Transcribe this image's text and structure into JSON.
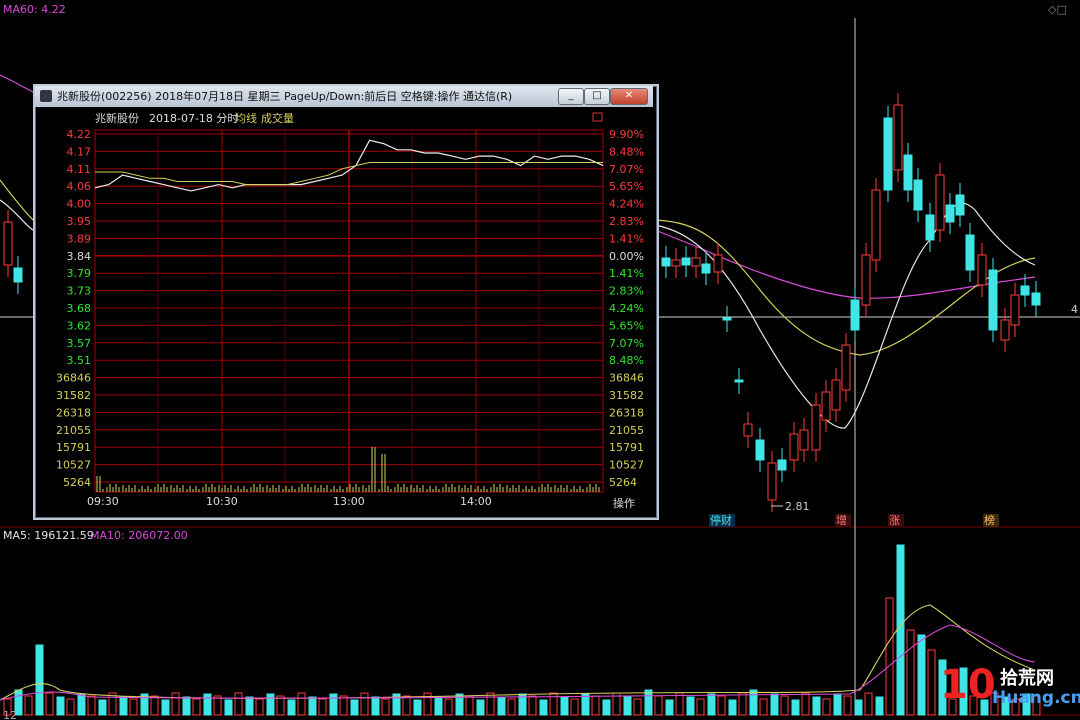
{
  "main": {
    "ma60_label": "MA60: 4.22",
    "price_label_right": "4",
    "low_marker": "2.81",
    "tags": [
      "停财",
      "增",
      "涨",
      "榜"
    ],
    "volume_labels": {
      "ma5": "MA5: 196121.59",
      "ma10": "MA10: 206072.00"
    },
    "bottom_axis_hint": "12",
    "watermark": {
      "big": "10",
      "cn": "拾荒网",
      "domain": "Huang.cn"
    }
  },
  "window": {
    "title": "兆新股份(002256) 2018年07月18日 星期三 PageUp/Down:前后日 空格键:操作 通达信(R)",
    "buttons": {
      "min": "_",
      "max": "□",
      "close": "✕"
    },
    "header": {
      "stock": "兆新股份",
      "date": "2018-07-18 分时",
      "avg_line": "均线",
      "volume": "成交量"
    },
    "footer_button": "操作"
  },
  "chart_data": [
    {
      "type": "line",
      "title": "兆新股份 2018-07-18 分时",
      "series": [
        {
          "name": "价格",
          "values": [
            4.05,
            4.06,
            4.09,
            4.08,
            4.07,
            4.06,
            4.05,
            4.04,
            4.05,
            4.06,
            4.05,
            4.06,
            4.06,
            4.06,
            4.06,
            4.06,
            4.07,
            4.08,
            4.09,
            4.12,
            4.2,
            4.19,
            4.17,
            4.17,
            4.16,
            4.16,
            4.15,
            4.14,
            4.15,
            4.15,
            4.14,
            4.12,
            4.15,
            4.14,
            4.15,
            4.15,
            4.14,
            4.12
          ]
        },
        {
          "name": "均线",
          "values": [
            4.1,
            4.1,
            4.1,
            4.09,
            4.08,
            4.08,
            4.07,
            4.07,
            4.07,
            4.07,
            4.07,
            4.06,
            4.06,
            4.06,
            4.06,
            4.07,
            4.08,
            4.09,
            4.11,
            4.12,
            4.13,
            4.13,
            4.13,
            4.13,
            4.13,
            4.13,
            4.13,
            4.13,
            4.13,
            4.13,
            4.13,
            4.13,
            4.13,
            4.13,
            4.13,
            4.13,
            4.13,
            4.13
          ]
        }
      ],
      "x_ticks": [
        "09:30",
        "10:30",
        "13:00",
        "14:00"
      ],
      "y_price_ticks": [
        "4.22",
        "4.17",
        "4.11",
        "4.06",
        "4.00",
        "3.95",
        "3.89",
        "3.84",
        "3.79",
        "3.73",
        "3.68",
        "3.62",
        "3.57",
        "3.51"
      ],
      "y_pct_ticks": [
        "9.90%",
        "8.48%",
        "7.07%",
        "5.65%",
        "4.24%",
        "2.83%",
        "1.41%",
        "0.00%",
        "1.41%",
        "2.83%",
        "4.24%",
        "5.65%",
        "7.07%",
        "8.48%"
      ],
      "y_vol_ticks": [
        "36846",
        "31582",
        "26318",
        "21055",
        "15791",
        "10527",
        "5264"
      ],
      "prev_close": 3.84,
      "ylim": [
        3.51,
        4.22
      ]
    },
    {
      "type": "candlestick",
      "low_label": "2.81",
      "labels": [
        "MA60: 4.22",
        "MA5: 196121.59",
        "MA10: 206072.00"
      ]
    }
  ],
  "colors": {
    "up": "#ff3a3a",
    "down": "#40e6e6",
    "ma_white": "#e6e6e6",
    "ma_yellow": "#d6cf5a",
    "ma_magenta": "#d84ad8",
    "grid_red": "#a00000"
  }
}
